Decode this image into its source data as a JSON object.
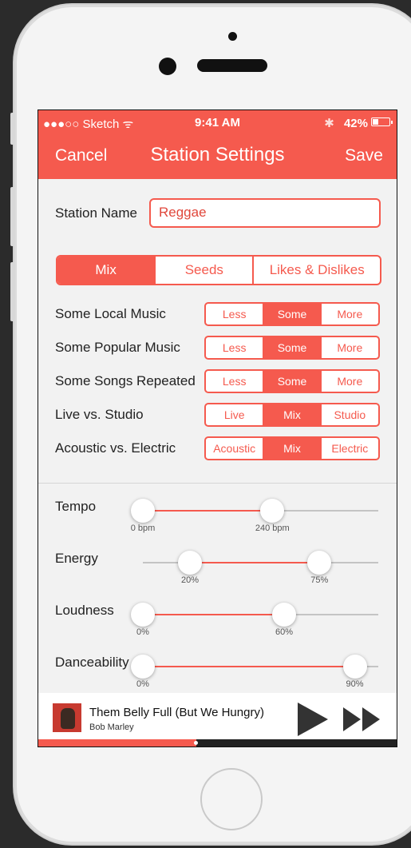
{
  "status": {
    "carrier": "●●●○○ Sketch ᯤ",
    "time": "9:41 AM",
    "bluetooth": "✱",
    "battery": "42%",
    "battery_level": 0.42
  },
  "nav": {
    "cancel": "Cancel",
    "title": "Station Settings",
    "save": "Save"
  },
  "station": {
    "label": "Station Name",
    "value": "Reggae"
  },
  "tabs": [
    {
      "label": "Mix",
      "active": true
    },
    {
      "label": "Seeds",
      "active": false
    },
    {
      "label": "Likes & Dislikes",
      "active": false
    }
  ],
  "options": [
    {
      "label": "Some Local Music",
      "choices": [
        "Less",
        "Some",
        "More"
      ],
      "selected": 1
    },
    {
      "label": "Some Popular Music",
      "choices": [
        "Less",
        "Some",
        "More"
      ],
      "selected": 1
    },
    {
      "label": "Some Songs Repeated",
      "choices": [
        "Less",
        "Some",
        "More"
      ],
      "selected": 1
    },
    {
      "label": "Live vs. Studio",
      "choices": [
        "Live",
        "Mix",
        "Studio"
      ],
      "selected": 1
    },
    {
      "label": "Acoustic vs. Electric",
      "choices": [
        "Acoustic",
        "Mix",
        "Electric"
      ],
      "selected": 1
    }
  ],
  "sliders": [
    {
      "label": "Tempo",
      "low": 0,
      "high": 0.55,
      "low_label": "0 bpm",
      "high_label": "240 bpm"
    },
    {
      "label": "Energy",
      "low": 0.2,
      "high": 0.75,
      "low_label": "20%",
      "high_label": "75%"
    },
    {
      "label": "Loudness",
      "low": 0,
      "high": 0.6,
      "low_label": "0%",
      "high_label": "60%"
    },
    {
      "label": "Danceability",
      "low": 0,
      "high": 0.9,
      "low_label": "0%",
      "high_label": "90%"
    }
  ],
  "player": {
    "song": "Them Belly Full (But We Hungry)",
    "artist": "Bob Marley",
    "progress": 0.44
  },
  "colors": {
    "accent": "#f55a4e"
  }
}
